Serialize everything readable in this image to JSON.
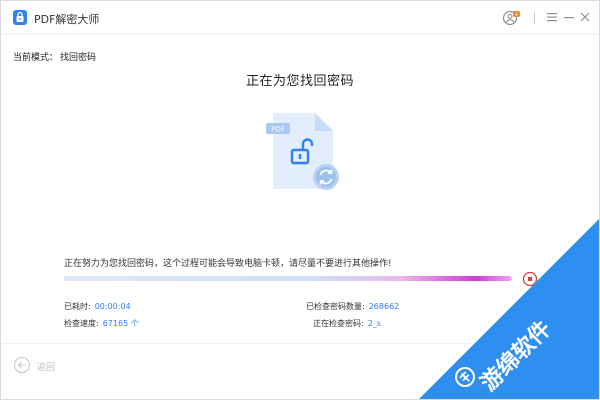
{
  "window": {
    "app_title": "PDF解密大师",
    "icons": {
      "logo": "padlock-logo",
      "user": "user-account-icon",
      "user_badge_color": "#f08a24",
      "menu": "hamburger-menu-icon",
      "minimize": "minimize-icon",
      "close": "close-icon"
    }
  },
  "mode": {
    "label": "当前模式：",
    "value": "找回密码"
  },
  "main": {
    "title": "正在为您找回密码",
    "illustration": {
      "badge": "PDF",
      "icons": [
        "pdf-file-icon",
        "unlocked-padlock-icon",
        "refresh-icon"
      ]
    }
  },
  "progress": {
    "message": "正在努力为您找回密码，这个过程可能会导致电脑卡顿，请尽量不要进行其他操作!",
    "fraction": 1.0,
    "stop_icon": "stop-icon",
    "accent_color": "#d13bd6"
  },
  "stats": {
    "elapsed_label": "已耗时:",
    "elapsed_value": "00:00:04",
    "speed_label": "检查速度:",
    "speed_value": "67165 个",
    "checked_label": "已检查密码数量:",
    "checked_value": "268662",
    "current_label": "正在检查密码:",
    "current_value": "2_s"
  },
  "footer": {
    "back_label": "返回",
    "back_icon": "back-arrow-icon"
  },
  "watermark": {
    "text": "游绵软件",
    "color": "#2f8ff0"
  },
  "colors": {
    "accent": "#2f7ff5",
    "stop": "#e23b3b"
  }
}
